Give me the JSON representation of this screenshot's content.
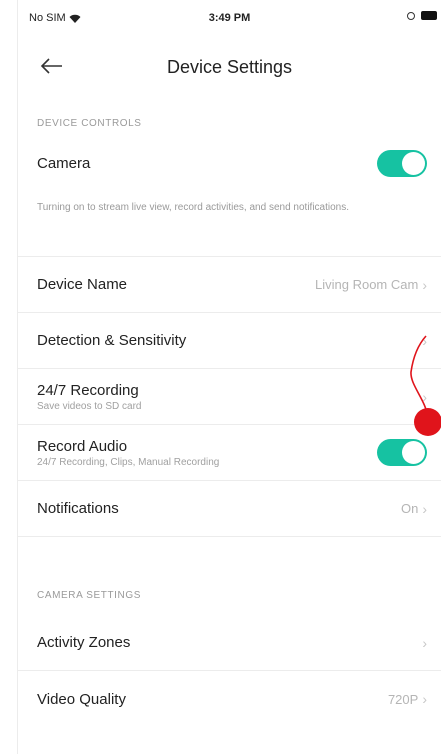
{
  "status_bar": {
    "carrier": "No SIM",
    "time": "3:49 PM"
  },
  "nav": {
    "title": "Device Settings"
  },
  "section_device_controls": {
    "header": "DEVICE CONTROLS"
  },
  "camera": {
    "label": "Camera",
    "enabled": true,
    "description": "Turning on to stream live view, record activities, and send notifications."
  },
  "device_name": {
    "label": "Device Name",
    "value": "Living Room Cam"
  },
  "detection": {
    "label": "Detection & Sensitivity"
  },
  "recording": {
    "label": "24/7 Recording",
    "sub": "Save videos to SD card"
  },
  "record_audio": {
    "label": "Record Audio",
    "sub": "24/7 Recording, Clips, Manual Recording",
    "enabled": true
  },
  "notifications": {
    "label": "Notifications",
    "value": "On"
  },
  "section_camera_settings": {
    "header": "CAMERA SETTINGS"
  },
  "activity_zones": {
    "label": "Activity Zones"
  },
  "video_quality": {
    "label": "Video Quality",
    "value": "720P"
  },
  "icons": {
    "back": "arrow-left-icon",
    "chevron": "chevron-right-icon",
    "wifi": "wifi-icon",
    "battery": "battery-icon",
    "marker": "red-dot-marker"
  },
  "colors": {
    "accent": "#16c2a2",
    "marker": "#e0141b"
  }
}
